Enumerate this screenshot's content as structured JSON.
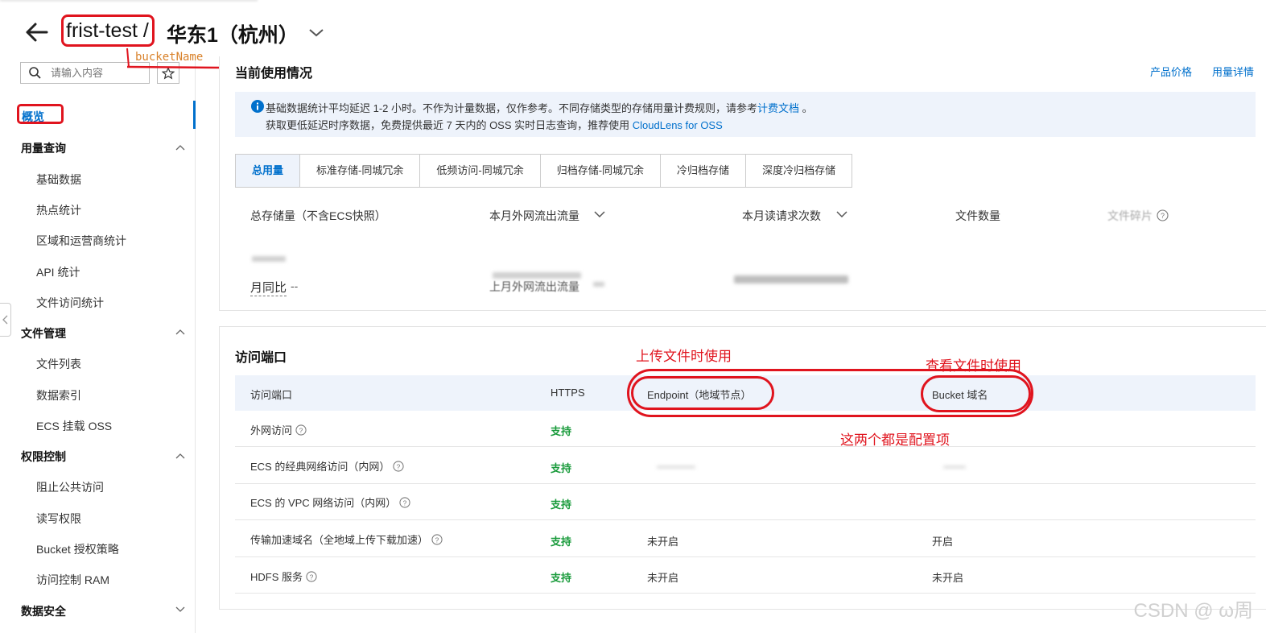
{
  "header": {
    "bucket_name": "frist-test",
    "separator": "/",
    "region": "华东1（杭州）"
  },
  "sidebar": {
    "search_placeholder": "请输入内容",
    "overview": "概览",
    "groups": [
      {
        "label": "用量查询",
        "items": [
          "基础数据",
          "热点统计",
          "区域和运营商统计",
          "API 统计",
          "文件访问统计"
        ]
      },
      {
        "label": "文件管理",
        "items": [
          "文件列表",
          "数据索引",
          "ECS 挂载 OSS"
        ]
      },
      {
        "label": "权限控制",
        "items": [
          "阻止公共访问",
          "读写权限",
          "Bucket 授权策略",
          "访问控制 RAM"
        ]
      },
      {
        "label": "数据安全",
        "items": []
      }
    ]
  },
  "usage": {
    "title": "当前使用情况",
    "links": {
      "pricing": "产品价格",
      "details": "用量详情"
    },
    "notice": {
      "line1": "基础数据统计平均延迟 1-2 小时。不作为计量数据，仅作参考。不同存储类型的存储用量计费规则，请参考",
      "line1_link": "计费文档",
      "line1_end": "。",
      "line2": "获取更低延迟时序数据，免费提供最近 7 天内的 OSS 实时日志查询，推荐使用",
      "line2_link": "CloudLens for OSS"
    },
    "tabs": [
      "总用量",
      "标准存储-同城冗余",
      "低频访问-同城冗余",
      "归档存储-同城冗余",
      "冷归档存储",
      "深度冷归档存储"
    ],
    "stats": {
      "storage": "总存储量（不含ECS快照）",
      "outbound": "本月外网流出流量",
      "reads": "本月读请求次数",
      "files": "文件数量",
      "fragments": "文件碎片"
    },
    "wow_label": "月同比",
    "wow_value": "--",
    "last_month_label": "上月外网流出流量"
  },
  "access": {
    "title": "访问端口",
    "headers": [
      "访问端口",
      "HTTPS",
      "Endpoint（地域节点）",
      "Bucket 域名"
    ],
    "rows": [
      {
        "name": "外网访问",
        "https": "支持",
        "endpoint": "",
        "domain": ""
      },
      {
        "name": "ECS 的经典网络访问（内网）",
        "https": "支持",
        "endpoint": "",
        "domain": ""
      },
      {
        "name": "ECS 的 VPC 网络访问（内网）",
        "https": "支持",
        "endpoint": "",
        "domain": ""
      },
      {
        "name": "传输加速域名（全地域上传下载加速）",
        "https": "支持",
        "endpoint": "未开启",
        "domain": "开启"
      },
      {
        "name": "HDFS 服务",
        "https": "支持",
        "endpoint": "未开启",
        "domain": "未开启"
      }
    ]
  },
  "annotations": {
    "bucket_name": "bucketName",
    "upload": "上传文件时使用",
    "view": "查看文件时使用",
    "config": "这两个都是配置项"
  },
  "watermark": "CSDN @        ω周",
  "colors": {
    "accent": "#0070cc",
    "success": "#1a9b3c",
    "annotation": "#e0141e"
  }
}
